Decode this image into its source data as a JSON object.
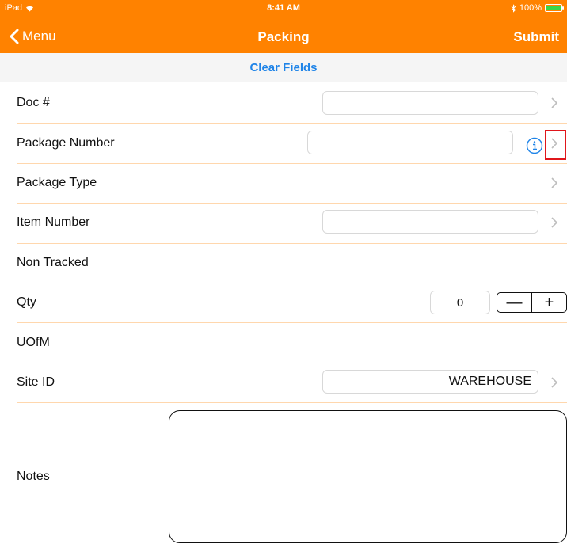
{
  "status_bar": {
    "device": "iPad",
    "time": "8:41 AM",
    "battery_text": "100%"
  },
  "nav": {
    "back_label": "Menu",
    "title": "Packing",
    "submit_label": "Submit"
  },
  "clear_label": "Clear Fields",
  "fields": {
    "doc": {
      "label": "Doc #",
      "value": ""
    },
    "package_number": {
      "label": "Package Number",
      "value": ""
    },
    "package_type": {
      "label": "Package Type"
    },
    "item_number": {
      "label": "Item Number",
      "value": ""
    },
    "non_tracked": {
      "label": "Non Tracked"
    },
    "qty": {
      "label": "Qty",
      "value": "0",
      "minus": "—",
      "plus": "+"
    },
    "uofm": {
      "label": "UOfM"
    },
    "site_id": {
      "label": "Site ID",
      "value": "WAREHOUSE"
    },
    "notes": {
      "label": "Notes",
      "value": ""
    }
  },
  "colors": {
    "brand": "#ff8200",
    "link": "#1f84e8",
    "separator": "#ffd7ad",
    "highlight": "#e0161b"
  }
}
